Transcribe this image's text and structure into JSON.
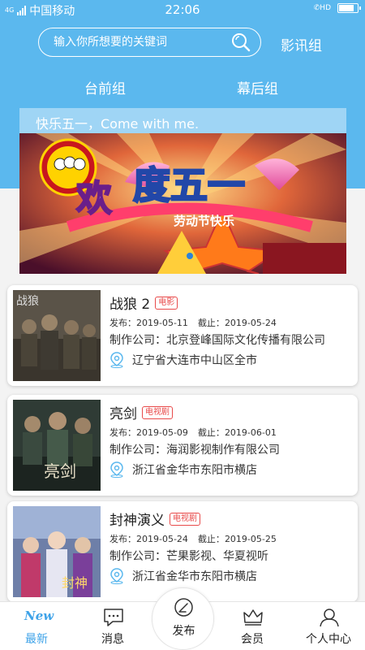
{
  "status_bar": {
    "network_label": "4G",
    "carrier": "中国移动",
    "time": "22:06",
    "hd_label": "HD",
    "battery_level": 0.85
  },
  "search": {
    "placeholder": "输入你所想要的关键词",
    "icon": "search-icon"
  },
  "header": {
    "yingxun_link": "影讯组"
  },
  "group_tabs": [
    {
      "label": "台前组"
    },
    {
      "label": "幕后组"
    }
  ],
  "banner": {
    "caption": "快乐五一，Come with me.",
    "image_text_1": "欢",
    "image_text_2": "度五一",
    "image_text_3": "劳动节快乐",
    "colors": {
      "caption_bg": "#9fd5f5",
      "header_bg": "#5bb8ee"
    }
  },
  "listings": [
    {
      "title": "战狼 2",
      "tag": "电影",
      "publish_label": "发布：",
      "publish_date": "2019-05-11",
      "deadline_label": "截止：",
      "deadline_date": "2019-05-24",
      "company_label": "制作公司：",
      "company": "北京登峰国际文化传播有限公司",
      "location": "辽宁省大连市中山区全市"
    },
    {
      "title": "亮剑",
      "tag": "电视剧",
      "publish_label": "发布：",
      "publish_date": "2019-05-09",
      "deadline_label": "截止：",
      "deadline_date": "2019-06-01",
      "company_label": "制作公司：",
      "company": "海润影视制作有限公司",
      "location": "浙江省金华市东阳市横店"
    },
    {
      "title": "封神演义",
      "tag": "电视剧",
      "publish_label": "发布：",
      "publish_date": "2019-05-24",
      "deadline_label": "截止：",
      "deadline_date": "2019-05-25",
      "company_label": "制作公司：",
      "company": "芒果影视、华夏视听",
      "location": "浙江省金华市东阳市横店"
    }
  ],
  "bottom_nav": {
    "new_badge": "New",
    "items": [
      {
        "label": "最新",
        "icon": "new-icon"
      },
      {
        "label": "消息",
        "icon": "message-icon"
      },
      {
        "label": "发布",
        "icon": "publish-icon"
      },
      {
        "label": "会员",
        "icon": "crown-icon"
      },
      {
        "label": "个人中心",
        "icon": "person-icon"
      }
    ]
  },
  "colors": {
    "accent": "#3fa3e8",
    "tag_red": "#e84a4a",
    "location_icon": "#5bb8ee"
  }
}
